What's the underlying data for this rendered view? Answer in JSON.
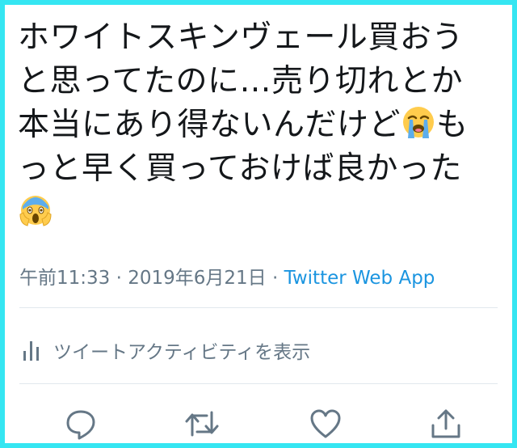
{
  "tweet": {
    "line1": "ホワイトスキンヴェール買おう",
    "line2": "と思ってたのに…売り切れとか",
    "line3_pre": "本当にあり得ないんだけど",
    "line3_post": "も",
    "line4": "っと早く買っておけば良かった"
  },
  "emojis": [
    "loudly-crying-face",
    "face-screaming-in-fear"
  ],
  "meta": {
    "time": "午前11:33",
    "sep1": " · ",
    "date": "2019年6月21日",
    "sep2": " · ",
    "source": "Twitter Web App"
  },
  "activity": {
    "label": "ツイートアクティビティを表示"
  },
  "colors": {
    "border": "#35e6f2",
    "text": "#14171a",
    "muted": "#657786",
    "link": "#1b95e0"
  }
}
